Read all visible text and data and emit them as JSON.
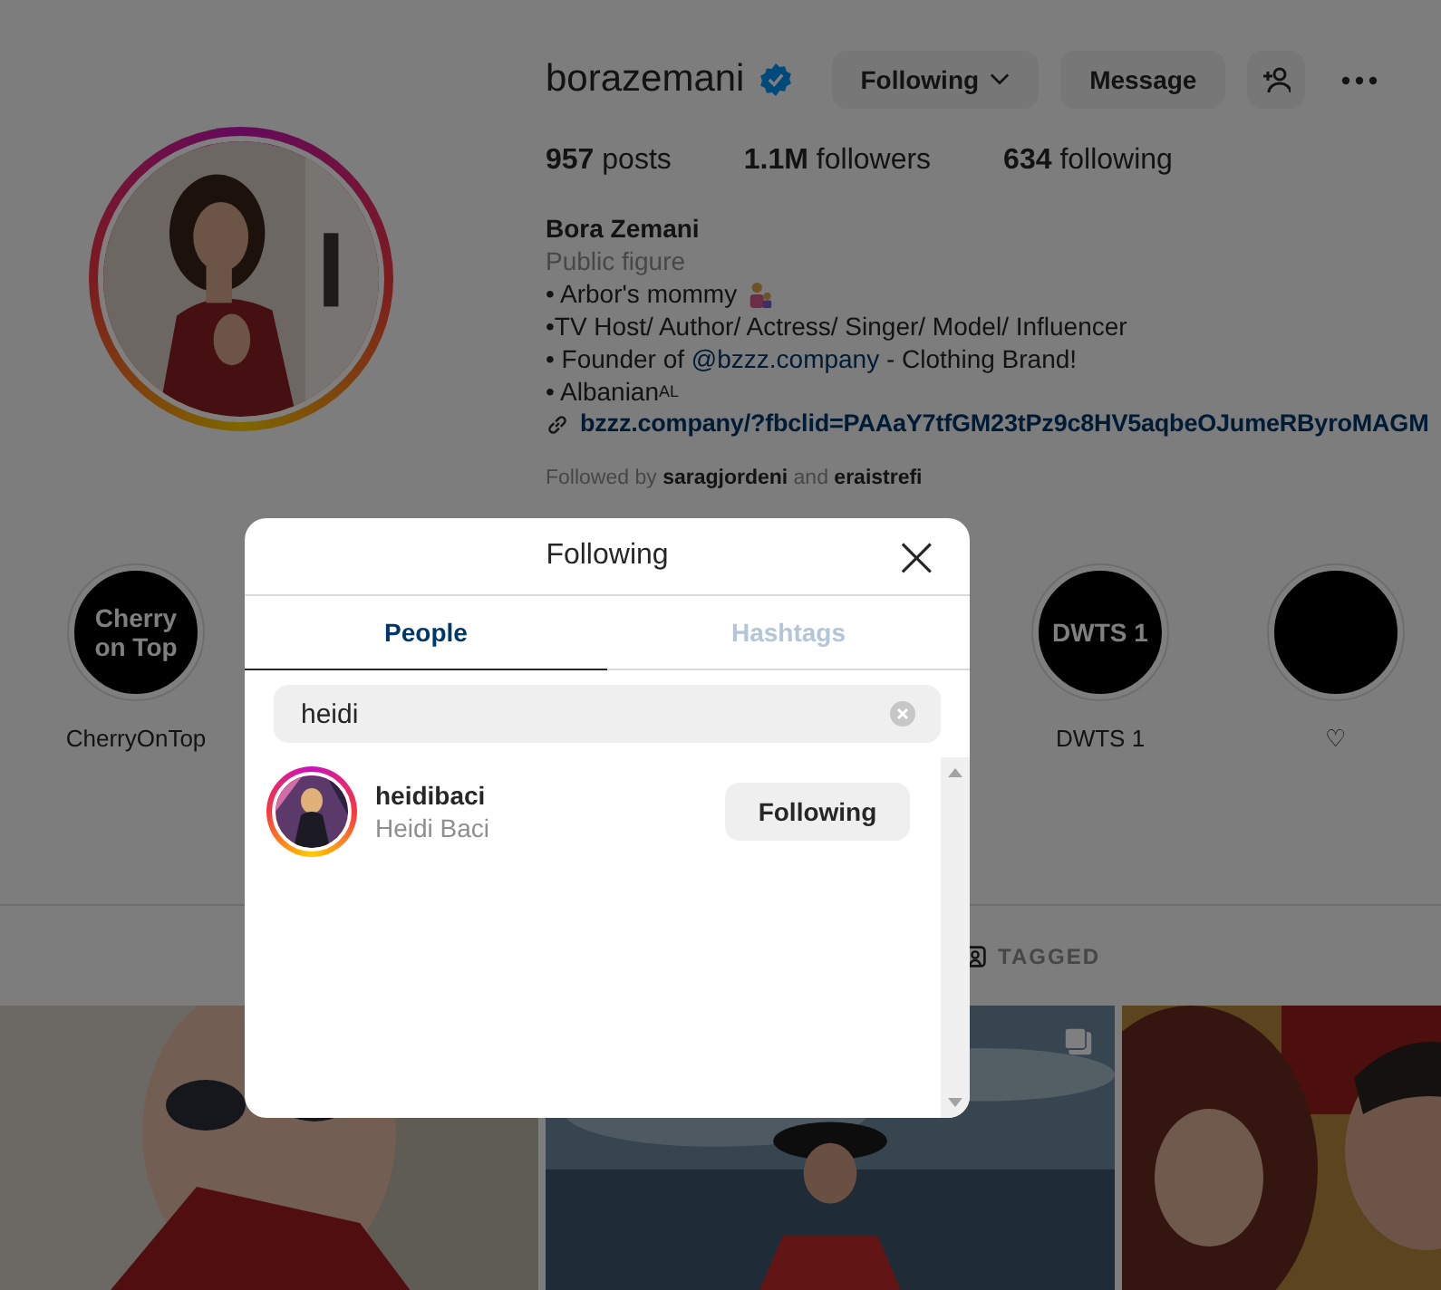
{
  "profile": {
    "username": "borazemani",
    "verified": true,
    "buttons": [
      {
        "kind": "dropdown",
        "label": "Following"
      },
      {
        "kind": "plain",
        "label": "Message"
      },
      {
        "kind": "suggest"
      },
      {
        "kind": "more"
      }
    ],
    "stats": [
      {
        "value": "957",
        "label": "posts"
      },
      {
        "value": "1.1M",
        "label": "followers"
      },
      {
        "value": "634",
        "label": "following"
      }
    ],
    "name": "Bora Zemani",
    "category": "Public figure",
    "bio": [
      {
        "kind": "emoji-family",
        "text": "• Arbor's mommy"
      },
      {
        "kind": "plain",
        "text": "•TV Host/ Author/ Actress/ Singer/ Model/ Influencer"
      },
      {
        "kind": "mention",
        "before": "• Founder of ",
        "mention": "@bzzz.company",
        "after": " - Clothing Brand!"
      },
      {
        "kind": "flag",
        "text": "• Albanian",
        "flag": "AL"
      }
    ],
    "link": "bzzz.company/?fbclid=PAAaY7tfGM23tPz9c8HV5aqbeOJumeRByroMAGM",
    "followed_by": {
      "prefix": "Followed by",
      "first": "saragjordeni",
      "joiner": "and",
      "second": "eraistrefi"
    }
  },
  "highlights": [
    {
      "cover": "Cherry on Top",
      "label": "CherryOnTop"
    },
    {
      "cover": "DWTS 1",
      "label": "DWTS 1"
    },
    {
      "label": "♡"
    }
  ],
  "profile_tabs": [
    {
      "label": "TAGGED",
      "selected": false
    }
  ],
  "posts": [
    {
      "kind": "picture"
    },
    {
      "kind": "picture",
      "multiple": true
    },
    {
      "kind": "picture"
    }
  ],
  "dialog": {
    "title": "Following",
    "close": "×",
    "tabs": [
      {
        "label": "People",
        "selected": true
      },
      {
        "label": "Hashtags",
        "selected": false
      }
    ],
    "search": {
      "value": "heidi"
    },
    "results": [
      {
        "username": "heidibaci",
        "name": "Heidi Baci",
        "button": "Following",
        "story_ring": true
      }
    ]
  }
}
